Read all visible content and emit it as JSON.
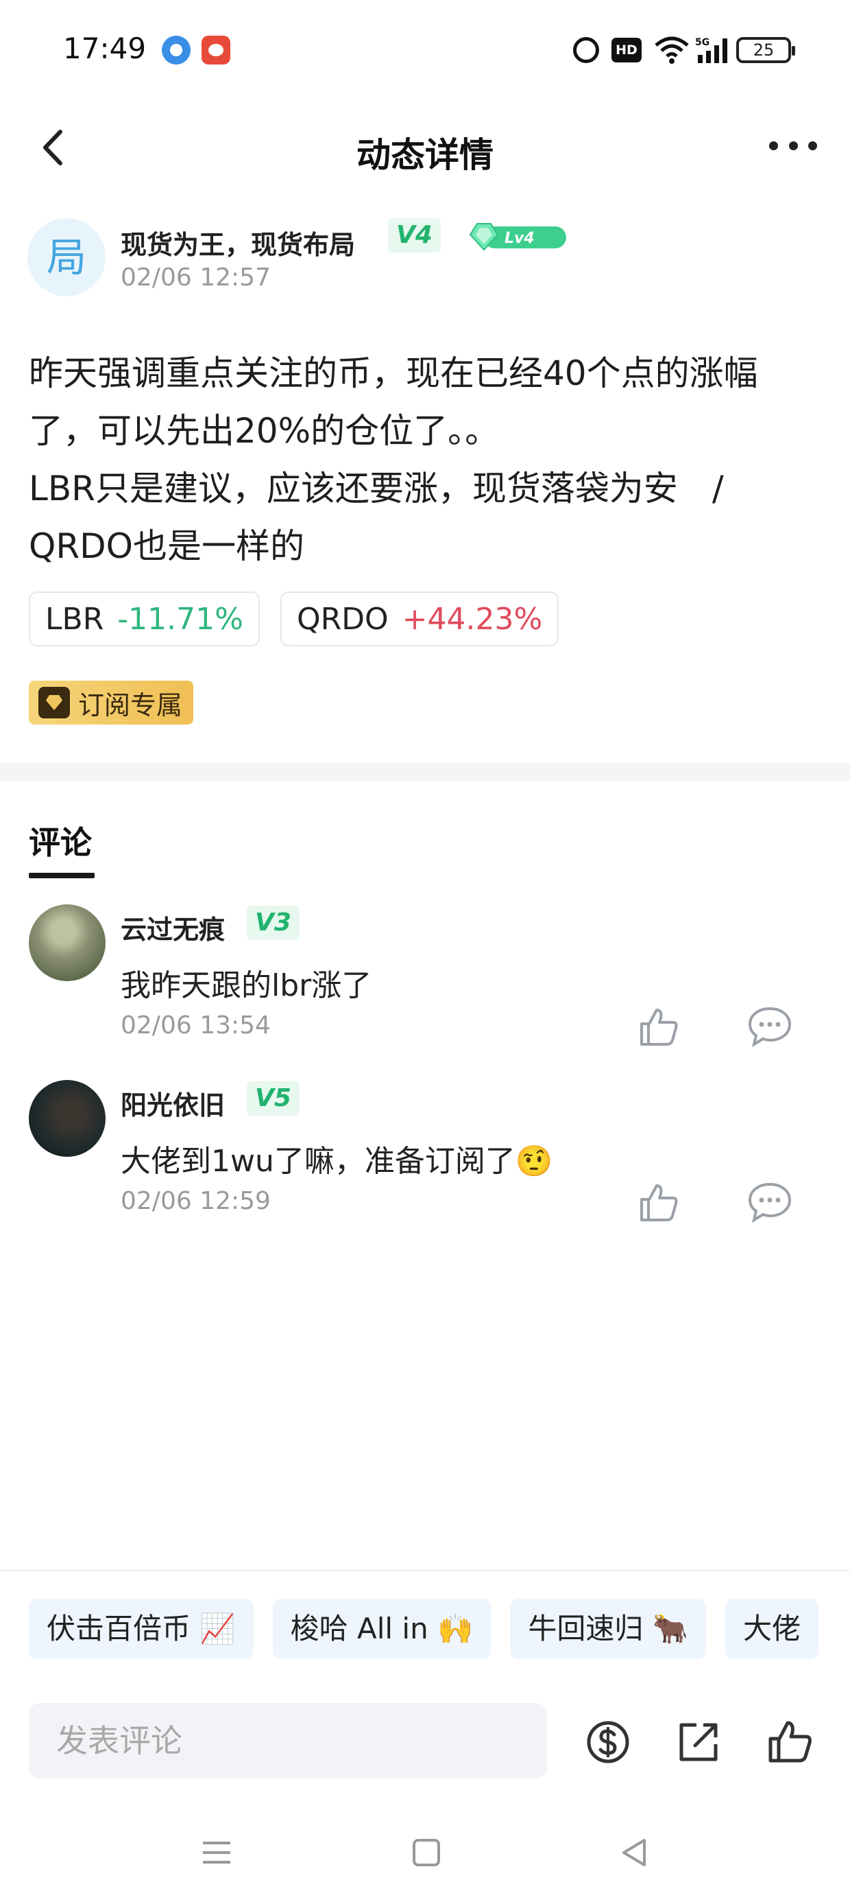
{
  "status_bar": {
    "time": "17:49",
    "hd_label": "HD",
    "battery": "25",
    "icons": [
      "browser-app-icon",
      "red-app-icon",
      "alarm-icon",
      "hd-icon",
      "wifi-icon",
      "5g-signal-icon",
      "battery-icon"
    ]
  },
  "nav": {
    "title": "动态详情",
    "back_icon": "back-arrow-icon",
    "more_icon": "more-dots-icon"
  },
  "author": {
    "avatar_letter": "局",
    "name": "现货为王，现货布局",
    "vip_badge": "V4",
    "level_badge": "Lv4",
    "date": "02/06 12:57"
  },
  "post": {
    "text": "昨天强调重点关注的币，现在已经40个点的涨幅了，可以先出20%的仓位了。。\nLBR只是建议，应该还要涨，现货落袋为安　/\nQRDO也是一样的",
    "tickers": [
      {
        "symbol": "LBR",
        "change": "-11.71%"
      },
      {
        "symbol": "QRDO",
        "change": "+44.23%"
      }
    ],
    "subscription_tag": "订阅专属"
  },
  "comments": {
    "tab_label": "评论",
    "items": [
      {
        "name": "云过无痕",
        "vip_badge": "V3",
        "text": "我昨天跟的lbr涨了",
        "date": "02/06 13:54"
      },
      {
        "name": "阳光依旧",
        "vip_badge": "V5",
        "text": "大佬到1wu了嘛，准备订阅了🤨",
        "date": "02/06 12:59"
      }
    ]
  },
  "quick_replies": [
    "伏击百倍币 📈",
    "梭哈 All in 🙌",
    "牛回速归 🐂",
    "大佬"
  ],
  "input": {
    "placeholder": "发表评论"
  },
  "colors": {
    "up": "#e04b5e",
    "down": "#2eb67d",
    "vip_green": "#22b46e",
    "chip_bg": "#eef5fd",
    "subscription_gold": "#f0bf55"
  }
}
